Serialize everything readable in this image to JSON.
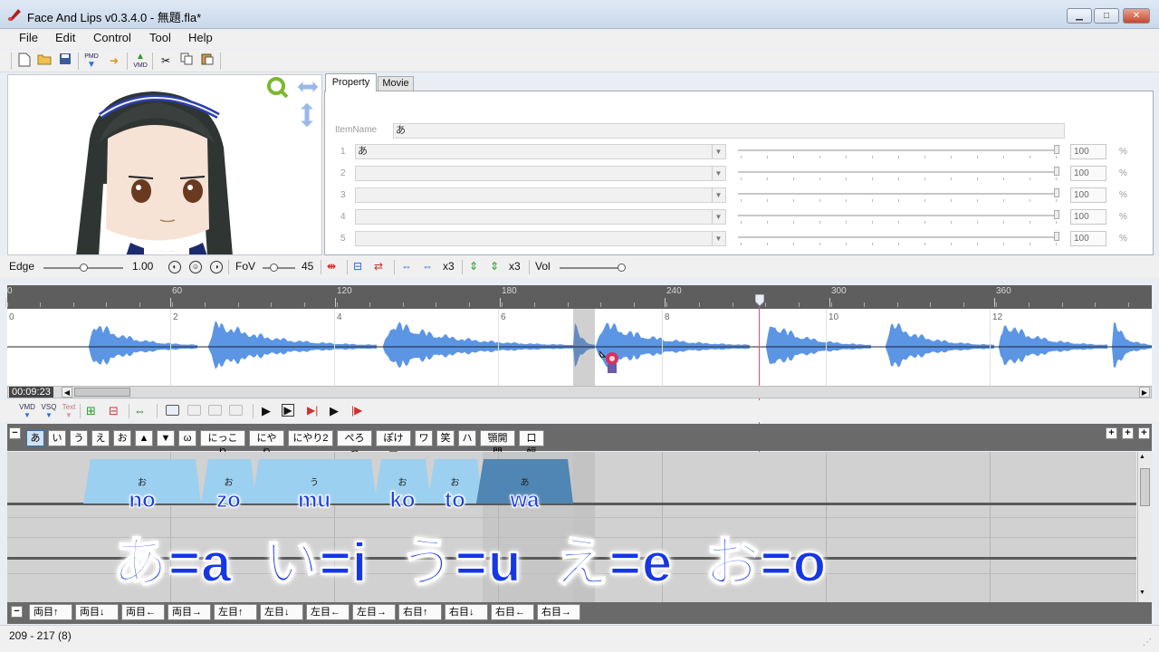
{
  "window": {
    "title": "Face And Lips v0.3.4.0 - 無題.fla*",
    "min": "▁",
    "max": "□",
    "close": "✕"
  },
  "menu": [
    "File",
    "Edit",
    "Control",
    "Tool",
    "Help"
  ],
  "toolbar": {
    "pmd": "PMD",
    "vmd": "VMD"
  },
  "tabs": {
    "property": "Property",
    "movie": "Movie"
  },
  "property": {
    "item_name_label": "ItemName",
    "item_name_value": "あ",
    "rows": [
      {
        "index": "1",
        "value": "あ",
        "amount": "100",
        "unit": "%"
      },
      {
        "index": "2",
        "value": "",
        "amount": "100",
        "unit": "%"
      },
      {
        "index": "3",
        "value": "",
        "amount": "100",
        "unit": "%"
      },
      {
        "index": "4",
        "value": "",
        "amount": "100",
        "unit": "%"
      },
      {
        "index": "5",
        "value": "",
        "amount": "100",
        "unit": "%"
      }
    ]
  },
  "controls": {
    "edge_label": "Edge",
    "edge_value": "1.00",
    "fov_label": "FoV",
    "fov_value": "45",
    "x3a": "x3",
    "x3b": "x3",
    "vol_label": "Vol"
  },
  "ruler": {
    "frames": [
      "0",
      "60",
      "120",
      "180",
      "240",
      "300",
      "360"
    ],
    "seconds": [
      "0",
      "2",
      "4",
      "6",
      "8",
      "10",
      "12"
    ]
  },
  "time": "00:09:23",
  "tool2": {
    "vsq": "VSQ",
    "text": "Text",
    "vmd": "VMD"
  },
  "phonemes": [
    "あ",
    "い",
    "う",
    "え",
    "お",
    "▲",
    "▼",
    "ω",
    "にっこり",
    "にやり",
    "にやり2",
    "ぺろっ",
    "ぽけー",
    "ワ",
    "笑",
    "ハ",
    "顎開閉",
    "口幅"
  ],
  "items": [
    {
      "label": "お",
      "romaji": "no"
    },
    {
      "label": "お",
      "romaji": "zo"
    },
    {
      "label": "う",
      "romaji": "mu"
    },
    {
      "label": "お",
      "romaji": "ko"
    },
    {
      "label": "お",
      "romaji": "to"
    },
    {
      "label": "あ",
      "romaji": "wa"
    }
  ],
  "guide_text": "あ=a い=i う=u え=e お=o",
  "eye_buttons": [
    "両目↑",
    "両目↓",
    "両目←",
    "両目→",
    "左目↑",
    "左目↓",
    "左目←",
    "左目→",
    "右目↑",
    "右目↓",
    "右目←",
    "右目→"
  ],
  "status": "209 - 217 (8)",
  "colors": {
    "wave": "#5b95e4",
    "item": "#9cd0f0",
    "item_selected": "#4f86b3",
    "playhead": "#e0507a"
  }
}
